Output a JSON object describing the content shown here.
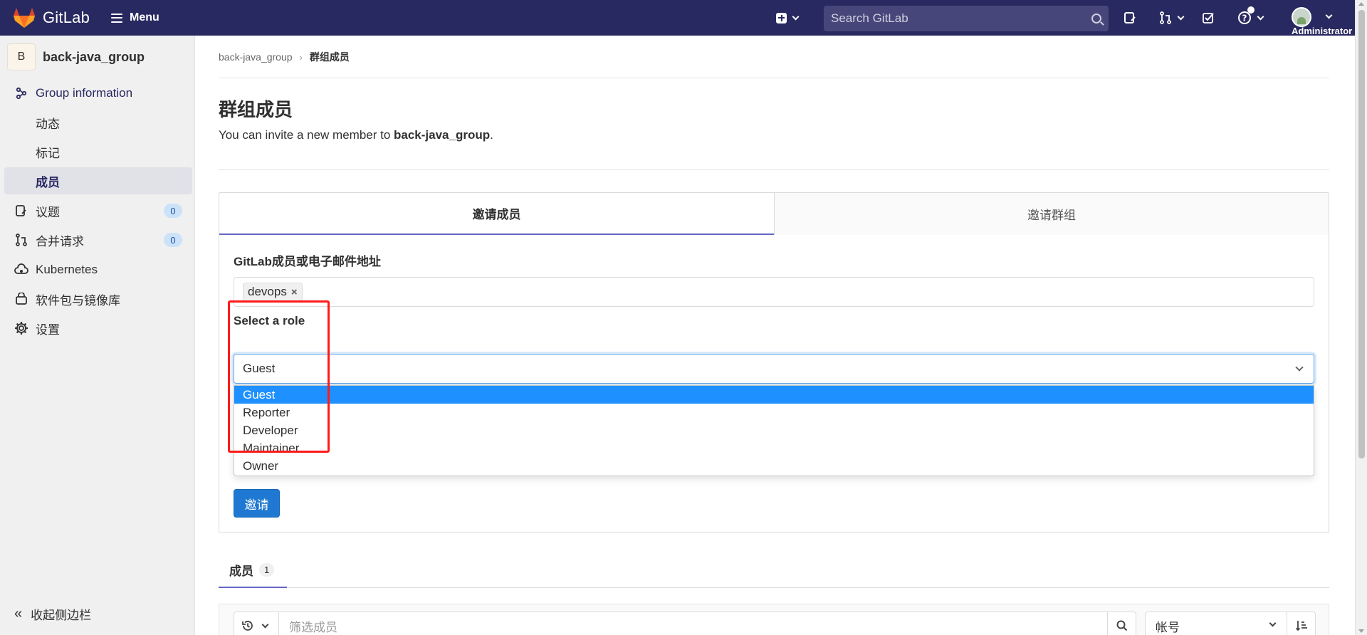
{
  "app": {
    "name": "GitLab",
    "menu_label": "Menu"
  },
  "search": {
    "placeholder": "Search GitLab"
  },
  "user": {
    "label": "Administrator"
  },
  "sidebar": {
    "group_initial": "B",
    "group_name": "back-java_group",
    "section_label": "Group information",
    "sub_items": [
      {
        "label": "动态"
      },
      {
        "label": "标记"
      },
      {
        "label": "成员"
      }
    ],
    "items": [
      {
        "label": "议题",
        "count": "0"
      },
      {
        "label": "合并请求",
        "count": "0"
      },
      {
        "label": "Kubernetes"
      },
      {
        "label": "软件包与镜像库"
      },
      {
        "label": "设置"
      }
    ],
    "collapse_label": "收起侧边栏"
  },
  "breadcrumb": {
    "parent": "back-java_group",
    "current": "群组成员"
  },
  "page": {
    "title": "群组成员",
    "invite_prefix": "You can invite a new member to ",
    "invite_group": "back-java_group",
    "invite_suffix": "."
  },
  "invite": {
    "tabs": [
      "邀请成员",
      "邀请群组"
    ],
    "member_field_label": "GitLab成员或电子邮件地址",
    "token": "devops",
    "role_label": "Select a role",
    "role_selected": "Guest",
    "role_options": [
      "Guest",
      "Reporter",
      "Developer",
      "Maintainer",
      "Owner"
    ],
    "submit_label": "邀请"
  },
  "members": {
    "tab_label": "成员",
    "count": "1",
    "filter_placeholder": "筛选成员",
    "sort_value": "帐号"
  },
  "colors": {
    "topbar": "#292961",
    "primary_button": "#1f78d1",
    "highlight_box": "#ff1a1a",
    "selected_option": "#1e90ff"
  }
}
